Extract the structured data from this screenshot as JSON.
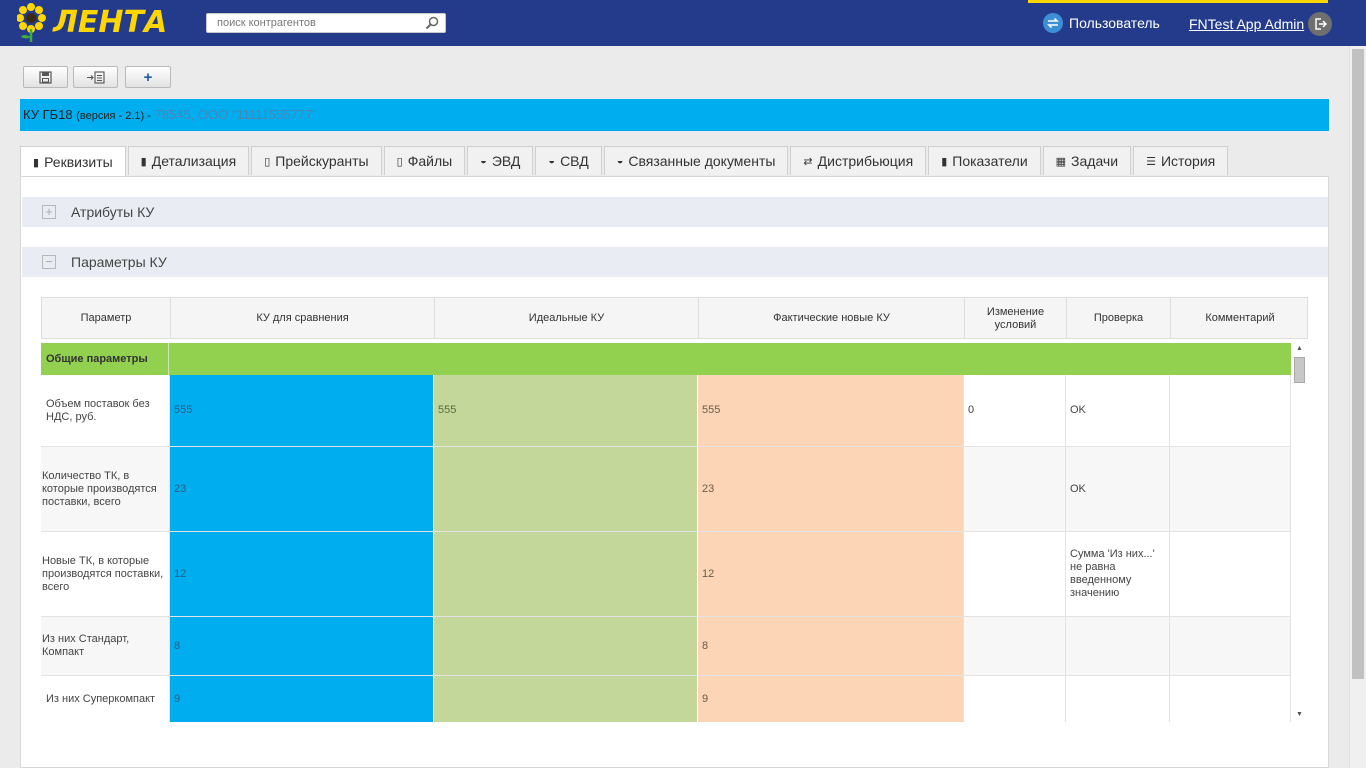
{
  "header": {
    "logo_text": "ЛЕНТА",
    "search_placeholder": "поиск контрагентов",
    "user_label": "Пользователь",
    "admin_label": "FNTest App Admin"
  },
  "toolbar": {
    "save_icon": "save-icon",
    "copy_icon": "copy-document-icon",
    "add_label": "+"
  },
  "banner": {
    "title": "КУ ГБ18",
    "version": "(версия - 2.1) -",
    "counterparty": "78545, ООО \"11111555777\""
  },
  "tabs": [
    {
      "label": "Реквизиты",
      "icon": "book-icon",
      "active": true
    },
    {
      "label": "Детализация",
      "icon": "book-icon"
    },
    {
      "label": "Прейскуранты",
      "icon": "file-icon"
    },
    {
      "label": "Файлы",
      "icon": "file-icon"
    },
    {
      "label": "ЭВД",
      "icon": "inbox-icon"
    },
    {
      "label": "СВД",
      "icon": "inbox-icon"
    },
    {
      "label": "Связанные документы",
      "icon": "inbox-icon"
    },
    {
      "label": "Дистрибьюция",
      "icon": "exchange-icon"
    },
    {
      "label": "Показатели",
      "icon": "book-icon"
    },
    {
      "label": "Задачи",
      "icon": "table-icon"
    },
    {
      "label": "История",
      "icon": "list-icon"
    }
  ],
  "sections": {
    "attributes": {
      "label": "Атрибуты КУ",
      "toggle": "+"
    },
    "params": {
      "label": "Параметры КУ",
      "toggle": "−"
    }
  },
  "grid": {
    "columns": [
      "Параметр",
      "КУ для сравнения",
      "Идеальные КУ",
      "Фактические новые КУ",
      "Изменение условий",
      "Проверка",
      "Комментарий"
    ],
    "group": "Общие параметры",
    "rows": [
      {
        "param": "Объем поставок без НДС, руб.",
        "cmp": "555",
        "ideal": "555",
        "fact": "555",
        "change": "0",
        "check": "OK",
        "comment": ""
      },
      {
        "param": "Количество ТК, в которые производятся поставки, всего",
        "cmp": "23",
        "ideal": "",
        "fact": "23",
        "change": "",
        "check": "OK",
        "comment": ""
      },
      {
        "param": "Новые ТК, в которые производятся поставки, всего",
        "cmp": "12",
        "ideal": "",
        "fact": "12",
        "change": "",
        "check": "Сумма 'Из них...' не равна введенному значению",
        "comment": ""
      },
      {
        "param": "Из них Стандарт, Компакт",
        "cmp": "8",
        "ideal": "",
        "fact": "8",
        "change": "",
        "check": "",
        "comment": ""
      },
      {
        "param": "Из них Суперкомпакт",
        "cmp": "9",
        "ideal": "",
        "fact": "9",
        "change": "",
        "check": "",
        "comment": ""
      }
    ]
  },
  "colors": {
    "header_bg": "#243b8c",
    "logo_yellow": "#ffd600",
    "banner_bg": "#00aeef",
    "group_green": "#92d050",
    "compare_blue": "#00aeef",
    "ideal_green": "#c4d79b",
    "fact_peach": "#fbd5b5"
  }
}
